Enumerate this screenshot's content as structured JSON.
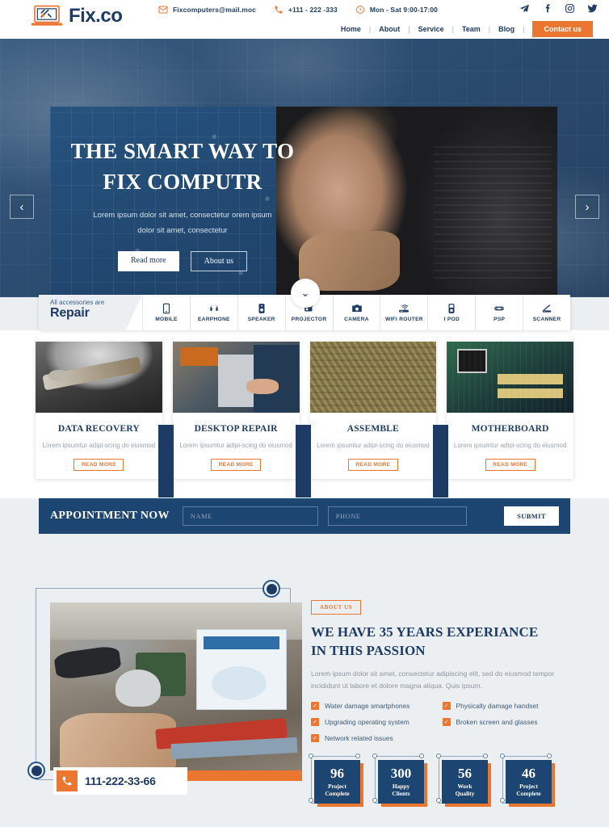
{
  "header": {
    "logo_text": "Fix.co",
    "logo_icon": "laptop-wrench-icon",
    "contacts": [
      {
        "icon": "envelope-icon",
        "text": "Fixcomputers@mail.moc"
      },
      {
        "icon": "phone-icon",
        "text": "+111 - 222 -333"
      },
      {
        "icon": "clock-icon",
        "text": "Mon - Sat 9:00-17:00"
      }
    ],
    "socials": [
      "telegram-icon",
      "facebook-icon",
      "instagram-icon",
      "twitter-icon"
    ],
    "nav": [
      "Home",
      "About",
      "Service",
      "Team",
      "Blog"
    ],
    "nav_separator": "|",
    "cta": "Contact us"
  },
  "hero": {
    "title_line1": "THE SMART WAY TO",
    "title_line2": "FIX COMPUTR",
    "paragraph_line1": "Lorem ipsum dolor sit amet, consectetur orem ipsum",
    "paragraph_line2": "dolor sit amet, consectetur",
    "btn_primary": "Read more",
    "btn_secondary": "About us",
    "prev_icon": "chevron-left-icon",
    "next_icon": "chevron-right-icon",
    "scroll_icon": "chevron-down-icon"
  },
  "repair_bar": {
    "eyebrow": "All accessories are",
    "title": "Repair",
    "items": [
      {
        "label": "MOBILE",
        "icon": "mobile-icon"
      },
      {
        "label": "EARPHONE",
        "icon": "headphone-icon"
      },
      {
        "label": "SPEAKER",
        "icon": "speaker-icon"
      },
      {
        "label": "PROJECTOR",
        "icon": "projector-icon"
      },
      {
        "label": "CAMERA",
        "icon": "camera-icon"
      },
      {
        "label": "WIFI ROUTER",
        "icon": "wifi-router-icon"
      },
      {
        "label": "I POD",
        "icon": "ipod-icon"
      },
      {
        "label": "PSP",
        "icon": "psp-icon"
      },
      {
        "label": "SCANNER",
        "icon": "scanner-icon"
      }
    ]
  },
  "services": [
    {
      "title": "DATA RECOVERY",
      "desc": "Lorem ipsumtur adipi-scing do eiusmod",
      "button": "READ MORE"
    },
    {
      "title": "DESKTOP REPAIR",
      "desc": "Lorem ipsumtur adipi-scing do eiusmod",
      "button": "READ MORE"
    },
    {
      "title": "ASSEMBLE",
      "desc": "Lorem ipsumtur adipi-scing do eiusmod",
      "button": "READ MORE"
    },
    {
      "title": "MOTHERBOARD",
      "desc": "Lorem ipsumtur adipi-scing do eiusmod",
      "button": "READ MORE"
    }
  ],
  "appointment": {
    "title": "APPOINTMENT NOW",
    "name_placeholder": "NAME",
    "name_value": "",
    "phone_placeholder": "PHONE",
    "phone_value": "",
    "submit": "SUBMIT"
  },
  "about": {
    "tag": "ABOUT US",
    "heading_line1": "WE HAVE 35 YEARS EXPERIANCE",
    "heading_line2": "IN THIS PASSION",
    "paragraph": "Lorem ipsum dolor sit amet, consectetur adipiscing elit, sed do eiusmod tempor incididunt ut labore et dolore magna aliqua. Quis ipsum.",
    "phone_badge": "111-222-33-66",
    "phone_icon": "phone-icon",
    "features": [
      "Water damage smartphones",
      "Physically damage handset",
      "Upgrading operating system",
      "Broken screen and glasses",
      "Network related issues"
    ],
    "check_glyph": "✓"
  },
  "stats": [
    {
      "number": "96",
      "label_line1": "Project",
      "label_line2": "Complete"
    },
    {
      "number": "300",
      "label_line1": "Happy",
      "label_line2": "Clients"
    },
    {
      "number": "56",
      "label_line1": "Work",
      "label_line2": "Quality"
    },
    {
      "number": "46",
      "label_line1": "Project",
      "label_line2": "Complete"
    }
  ],
  "colors": {
    "brand_blue": "#1d3b64",
    "panel_blue": "#1d4571",
    "accent_orange": "#ea7630",
    "page_bg": "#eceff1"
  }
}
